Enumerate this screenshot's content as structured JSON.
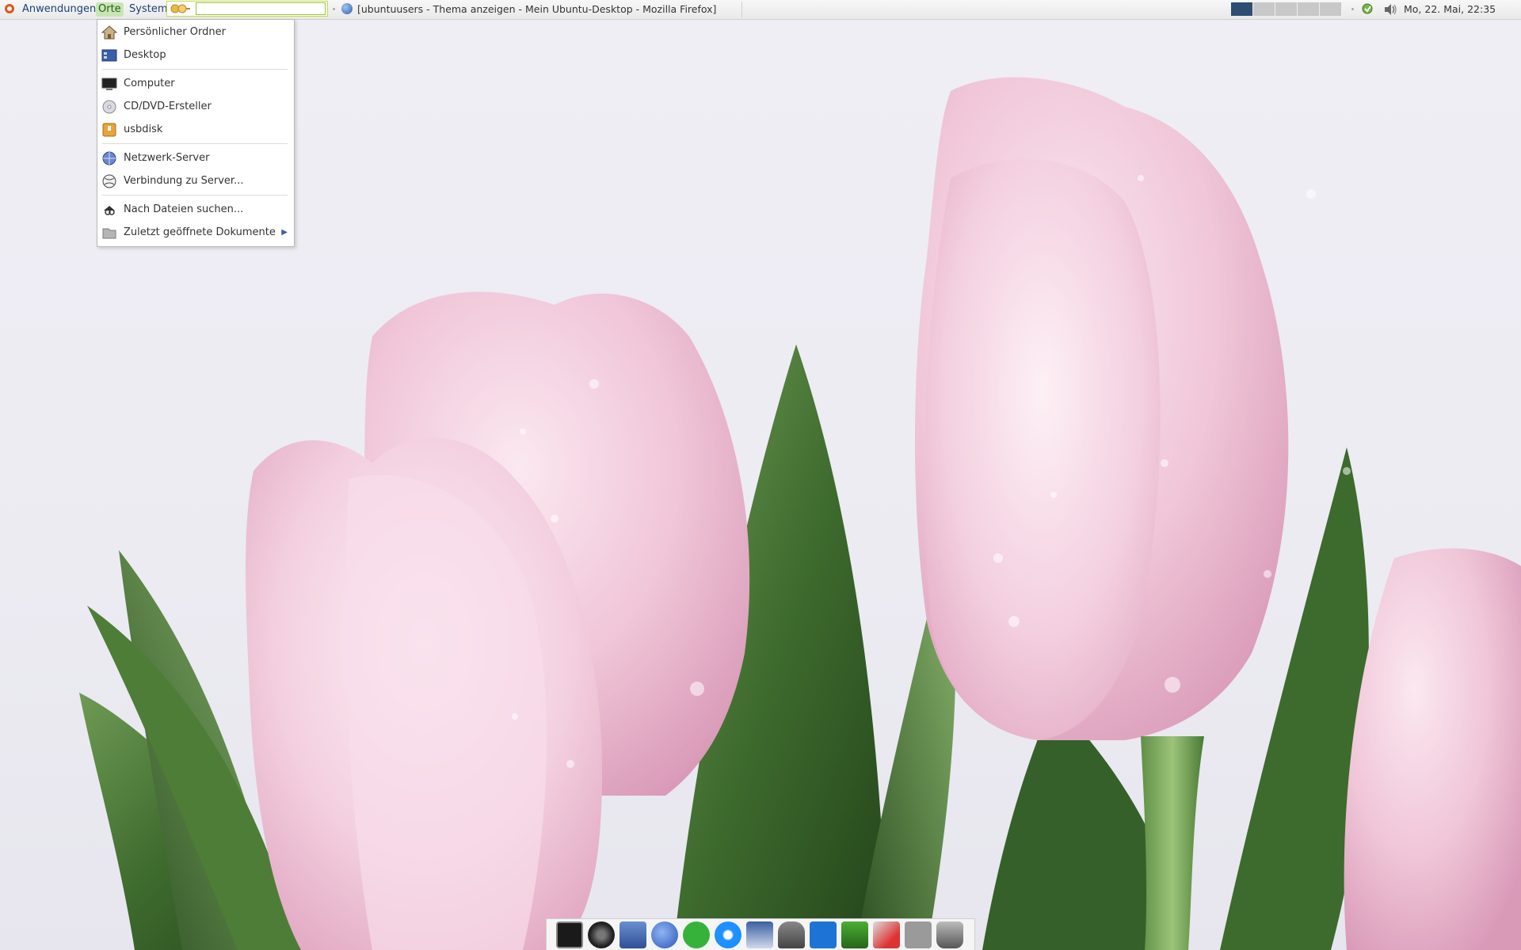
{
  "panel": {
    "menus": {
      "applications": "Anwendungen",
      "places": "Orte",
      "system": "System"
    },
    "search": {
      "value": "",
      "placeholder": ""
    },
    "task": {
      "title": "[ubuntuusers - Thema anzeigen - Mein Ubuntu-Desktop - Mozilla Firefox]"
    },
    "workspaces": {
      "count": 5,
      "active_index": 0
    },
    "clock": "Mo, 22. Mai, 22:35"
  },
  "places_menu": {
    "items": [
      {
        "label": "Persönlicher Ordner",
        "icon": "home-folder-icon"
      },
      {
        "label": "Desktop",
        "icon": "desktop-icon"
      },
      {
        "label": "Computer",
        "icon": "computer-icon"
      },
      {
        "label": "CD/DVD-Ersteller",
        "icon": "cd-dvd-icon"
      },
      {
        "label": "usbdisk",
        "icon": "usb-disk-icon"
      },
      {
        "label": "Netzwerk-Server",
        "icon": "network-server-icon"
      },
      {
        "label": "Verbindung zu Server...",
        "icon": "connect-server-icon"
      },
      {
        "label": "Nach Dateien suchen...",
        "icon": "file-search-icon"
      },
      {
        "label": "Zuletzt geöffnete Dokumente",
        "icon": "recent-documents-icon"
      }
    ]
  },
  "dock": {
    "icons": [
      "terminal-icon",
      "camera-icon",
      "file-manager-icon",
      "pidgin-icon",
      "skype-icon",
      "browser-icon",
      "video-editor-icon",
      "gimp-icon",
      "writer-icon",
      "network-tool-icon",
      "draw-icon",
      "calculator-icon",
      "trash-icon"
    ]
  },
  "colors": {
    "panel_text": "#1f3f78",
    "active_workspace": "#2d4d73",
    "menu_highlight": "#c7e6b4",
    "tulip_pink": "#f2cadc",
    "leaf_green": "#3f6b30"
  }
}
